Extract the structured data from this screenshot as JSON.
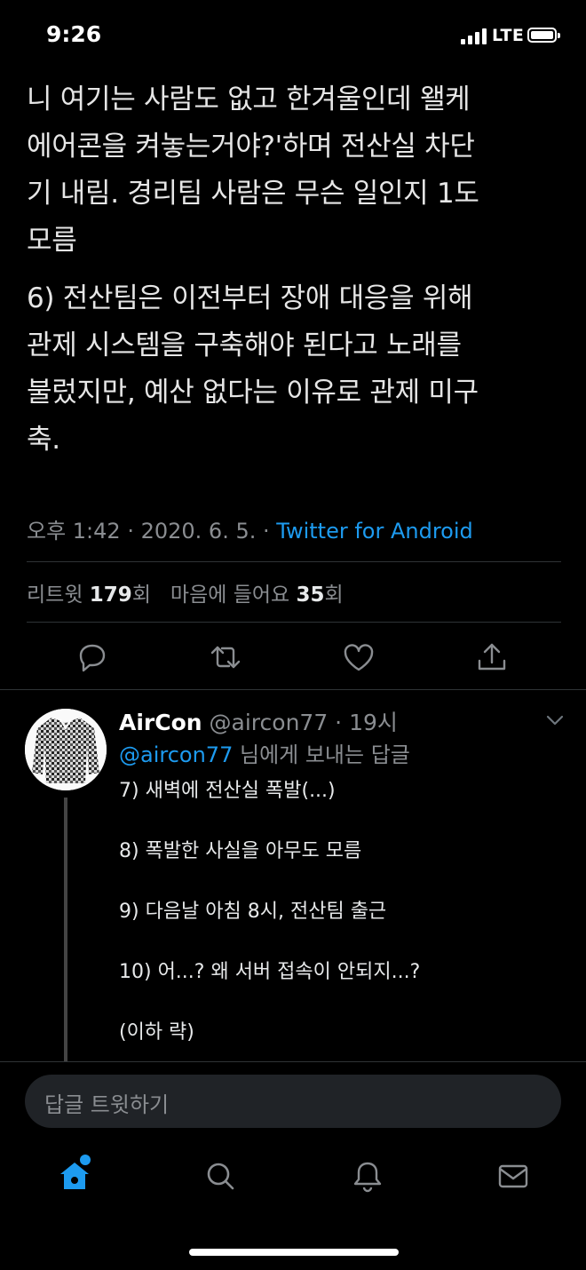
{
  "status_bar": {
    "time": "9:26",
    "network": "LTE"
  },
  "tweet": {
    "paragraphs": [
      "니 여기는 사람도 없고 한겨울인데 왤케\n에어콘을 켜놓는거야?'하며 전산실 차단\n기 내림. 경리팀 사람은 무슨 일인지 1도\n모름",
      "6) 전산팀은 이전부터 장애 대응을 위해\n관제 시스템을 구축해야 된다고 노래를\n불렀지만, 예산 없다는 이유로 관제 미구\n축."
    ],
    "time": "오후 1:42",
    "date": "2020. 6. 5.",
    "source": "Twitter for Android",
    "retweet_label": "리트윗",
    "retweet_count": "179",
    "like_label": "마음에 들어요",
    "like_count": "35",
    "count_suffix": "회"
  },
  "actions": {
    "reply_icon": "reply-icon",
    "retweet_icon": "retweet-icon",
    "like_icon": "heart-icon",
    "share_icon": "share-icon"
  },
  "reply": {
    "name": "AirCon",
    "handle": "@aircon77",
    "age": "19시",
    "mention": "@aircon77",
    "reply_to_suffix": "님에게 보내는 답글",
    "lines": [
      "7) 새벽에 전산실 폭발(...)",
      "8) 폭발한 사실을 아무도 모름",
      "9) 다음날 아침 8시, 전산팀 출근",
      "10) 어...? 왜 서버 접속이 안되지...?",
      "(이하 략)"
    ]
  },
  "composer": {
    "placeholder": "답글 트윗하기"
  },
  "tab_bar": [
    "home-icon",
    "search-icon",
    "bell-icon",
    "mail-icon"
  ],
  "colors": {
    "accent": "#1d9bf0",
    "background": "#000000",
    "secondary_text": "#8a8d91"
  }
}
